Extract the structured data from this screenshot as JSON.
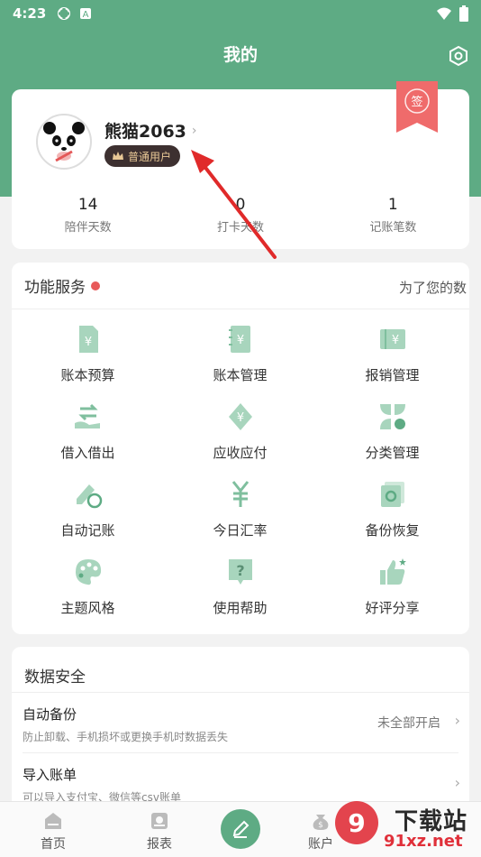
{
  "status_bar": {
    "time": "4:23"
  },
  "header": {
    "title": "我的"
  },
  "profile": {
    "username": "熊猫2063",
    "badge": "普通用户",
    "ribbon_char": "签",
    "stats": [
      {
        "num": "14",
        "label": "陪伴天数"
      },
      {
        "num": "0",
        "label": "打卡天数"
      },
      {
        "num": "1",
        "label": "记账笔数"
      }
    ]
  },
  "services": {
    "title": "功能服务",
    "marquee": "为了您的数",
    "items": [
      {
        "label": "账本预算",
        "icon": "budget-book-icon"
      },
      {
        "label": "账本管理",
        "icon": "ledger-manage-icon"
      },
      {
        "label": "报销管理",
        "icon": "reimburse-icon"
      },
      {
        "label": "借入借出",
        "icon": "lend-borrow-icon"
      },
      {
        "label": "应收应付",
        "icon": "receivable-icon"
      },
      {
        "label": "分类管理",
        "icon": "category-icon"
      },
      {
        "label": "自动记账",
        "icon": "auto-record-icon"
      },
      {
        "label": "今日汇率",
        "icon": "exchange-rate-icon"
      },
      {
        "label": "备份恢复",
        "icon": "backup-restore-icon"
      },
      {
        "label": "主题风格",
        "icon": "palette-icon"
      },
      {
        "label": "使用帮助",
        "icon": "help-icon"
      },
      {
        "label": "好评分享",
        "icon": "thumbs-up-icon"
      }
    ]
  },
  "data_security": {
    "title": "数据安全",
    "rows": [
      {
        "title": "自动备份",
        "subtitle": "防止卸载、手机损坏或更换手机时数据丢失",
        "value": "未全部开启"
      },
      {
        "title": "导入账单",
        "subtitle": "可以导入支付宝、微信等csv账单",
        "value": ""
      }
    ]
  },
  "tabbar": {
    "tabs": [
      {
        "label": "首页",
        "icon": "home-icon"
      },
      {
        "label": "报表",
        "icon": "report-icon"
      },
      {
        "label": "账户",
        "icon": "account-icon"
      }
    ]
  },
  "watermark": {
    "text": "下载站",
    "url": "91xz.net"
  },
  "colors": {
    "accent": "#5eab84",
    "icon_fill": "#a8d5bd",
    "badge_bg": "#3d3030",
    "red": "#e85a5a",
    "ribbon": "#ef6b6b"
  }
}
